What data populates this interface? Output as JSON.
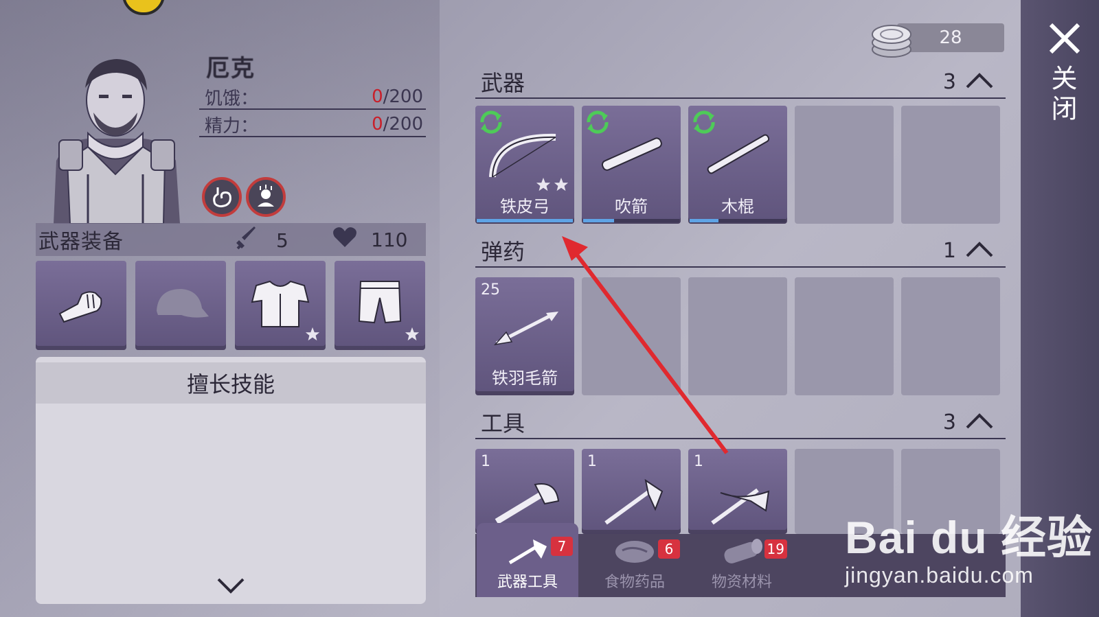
{
  "character": {
    "name": "厄克",
    "hunger_label": "饥饿：",
    "hunger_current": "0",
    "hunger_max": "/200",
    "energy_label": "精力：",
    "energy_current": "0",
    "energy_max": "/200",
    "status_icons": [
      "stomach-icon",
      "exhausted-icon"
    ]
  },
  "equipment": {
    "title": "武器装备",
    "attack": "5",
    "health": "110",
    "slots": [
      "fist-icon",
      "cap-icon",
      "armor-vest-icon",
      "pants-icon"
    ]
  },
  "skills": {
    "title": "擅长技能"
  },
  "currency": {
    "amount": "28"
  },
  "inventory": {
    "weapons": {
      "title": "武器",
      "count": "3",
      "items": [
        {
          "name": "铁皮弓",
          "icon": "bow-icon",
          "stars": 2,
          "durability": 1.0
        },
        {
          "name": "吹箭",
          "icon": "blowgun-icon",
          "stars": 0,
          "durability": 0.32
        },
        {
          "name": "木棍",
          "icon": "stick-icon",
          "stars": 0,
          "durability": 0.3
        }
      ]
    },
    "ammo": {
      "title": "弹药",
      "count": "1",
      "items": [
        {
          "name": "铁羽毛箭",
          "icon": "arrow-icon",
          "qty": "25"
        }
      ]
    },
    "tools": {
      "title": "工具",
      "count": "3",
      "items": [
        {
          "icon": "axe-icon",
          "qty": "1"
        },
        {
          "icon": "hatchet-icon",
          "qty": "1"
        },
        {
          "icon": "pickaxe-icon",
          "qty": "1"
        }
      ]
    }
  },
  "tabs": [
    {
      "label": "武器工具",
      "badge": "7",
      "active": true
    },
    {
      "label": "食物药品",
      "badge": "6",
      "active": false
    },
    {
      "label": "物资材料",
      "badge": "19",
      "active": false
    }
  ],
  "close_label": "关闭",
  "watermark": {
    "brand": "Bai du 经验",
    "url": "jingyan.baidu.com"
  },
  "colors": {
    "accent_red": "#c91f2a",
    "slot_purple": "#6c6088",
    "durability_blue": "#5fa4e6",
    "badge_red": "#d7323f"
  }
}
